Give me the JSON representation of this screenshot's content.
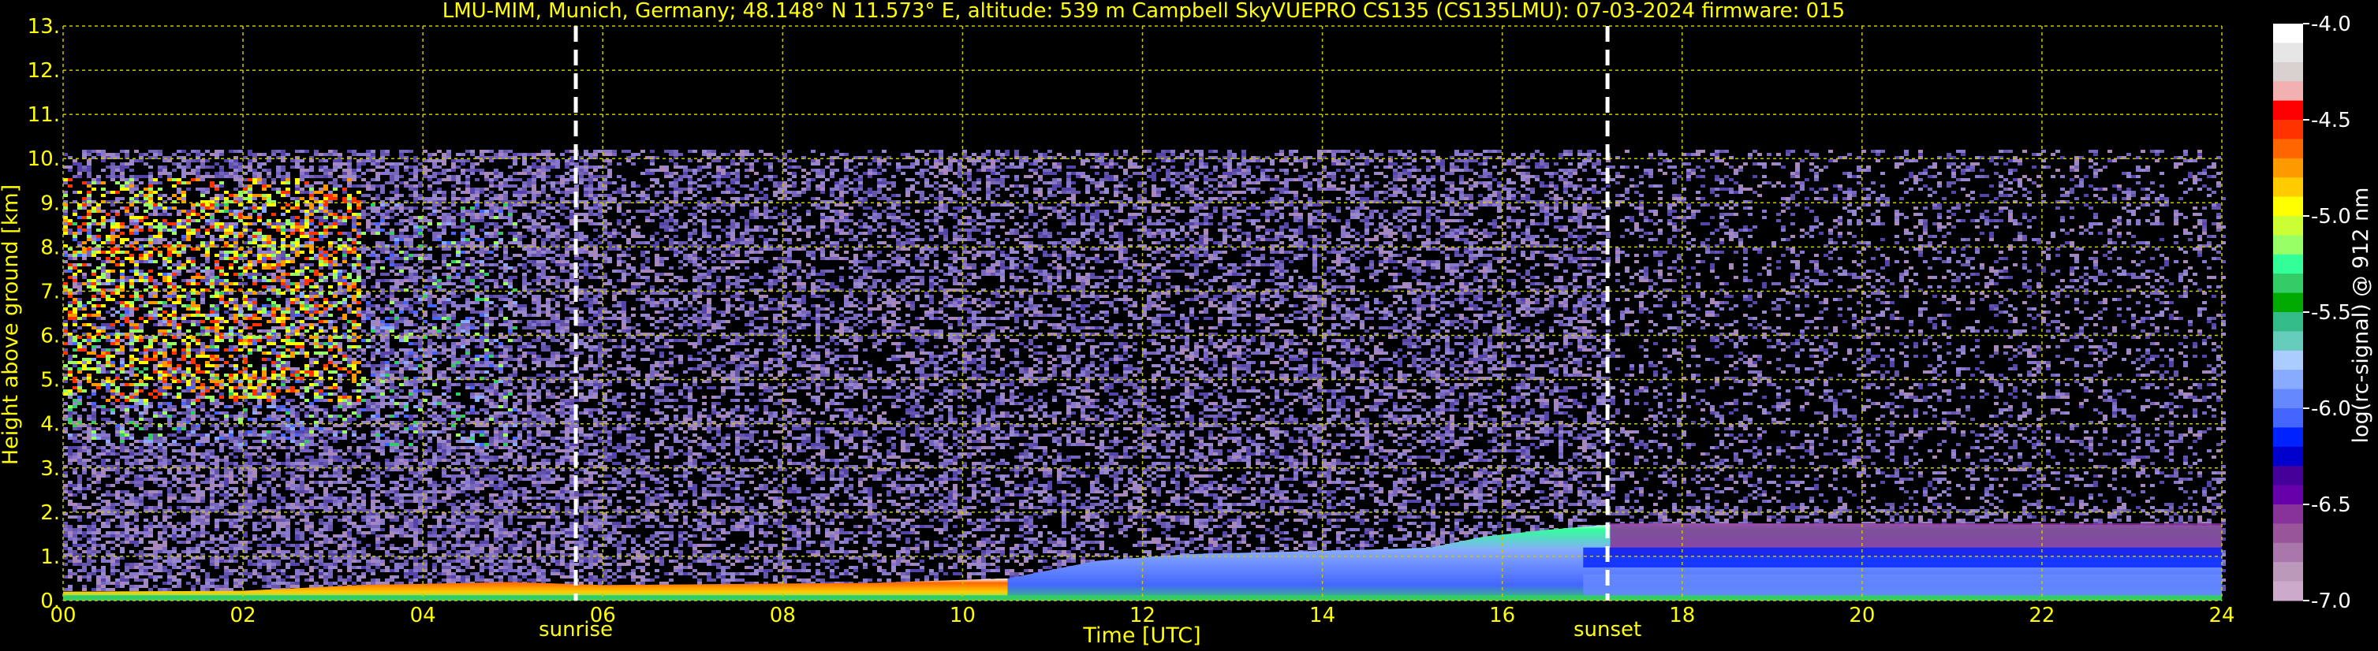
{
  "title": "LMU-MIM, Munich, Germany; 48.148° N 11.573° E, altitude: 539 m    Campbell SkyVUEPRO CS135 (CS135LMU): 07-03-2024    firmware: 015",
  "chart_data": {
    "type": "heatmap",
    "title": "LMU-MIM, Munich, Germany; 48.148° N 11.573° E, altitude: 539 m    Campbell SkyVUEPRO CS135 (CS135LMU): 07-03-2024    firmware: 015",
    "xlabel": "Time [UTC]",
    "ylabel": "Height above ground [km]",
    "colorbar_label": "log(rc-signal) @ 912 nm",
    "xlim": [
      0,
      24
    ],
    "ylim": [
      0,
      13
    ],
    "x_ticks": [
      "00",
      "02",
      "04",
      "06",
      "08",
      "10",
      "12",
      "14",
      "16",
      "18",
      "20",
      "22",
      "24"
    ],
    "y_ticks": [
      "0.",
      "1.",
      "2.",
      "3.",
      "4.",
      "5.",
      "6.",
      "7.",
      "8.",
      "9.",
      "10.",
      "11.",
      "12.",
      "13."
    ],
    "colorbar_range": [
      -7.0,
      -4.0
    ],
    "colorbar_ticks": [
      "-4.0",
      "-4.5",
      "-5.0",
      "-5.5",
      "-6.0",
      "-6.5",
      "-7.0"
    ],
    "grid": true,
    "grid_color": "#c8c800",
    "annotations": [
      {
        "label": "sunrise",
        "time": 5.7
      },
      {
        "label": "sunset",
        "time": 17.17
      }
    ],
    "boundary_layer_top_km": {
      "time": [
        0,
        2,
        3.3,
        5,
        6,
        9,
        10.5,
        11.5,
        12.5,
        13.5,
        14.5,
        15.2,
        15.8,
        16.5,
        17.2,
        17.8
      ],
      "height": [
        0.2,
        0.22,
        0.35,
        0.42,
        0.35,
        0.4,
        0.5,
        0.9,
        1.05,
        1.1,
        1.15,
        1.2,
        1.45,
        1.6,
        1.72,
        1.75
      ]
    },
    "signal_top_km": 10.2
  },
  "colors": {
    "background": "#000000",
    "text": "#ffff00",
    "colorbar": [
      "#ffffff",
      "#e6e6e6",
      "#d9d0d0",
      "#f2b0b0",
      "#ff0000",
      "#ff3300",
      "#ff6600",
      "#ff9900",
      "#ffcc00",
      "#ffff00",
      "#ccff33",
      "#99ff66",
      "#33ff99",
      "#33cc66",
      "#00aa00",
      "#33bb88",
      "#66ccbb",
      "#aaccff",
      "#88aaff",
      "#6688ff",
      "#4466ff",
      "#0022ff",
      "#0000cc",
      "#440099",
      "#6600aa",
      "#883399",
      "#995599",
      "#aa77aa",
      "#bb99bb",
      "#ccaacc"
    ]
  }
}
